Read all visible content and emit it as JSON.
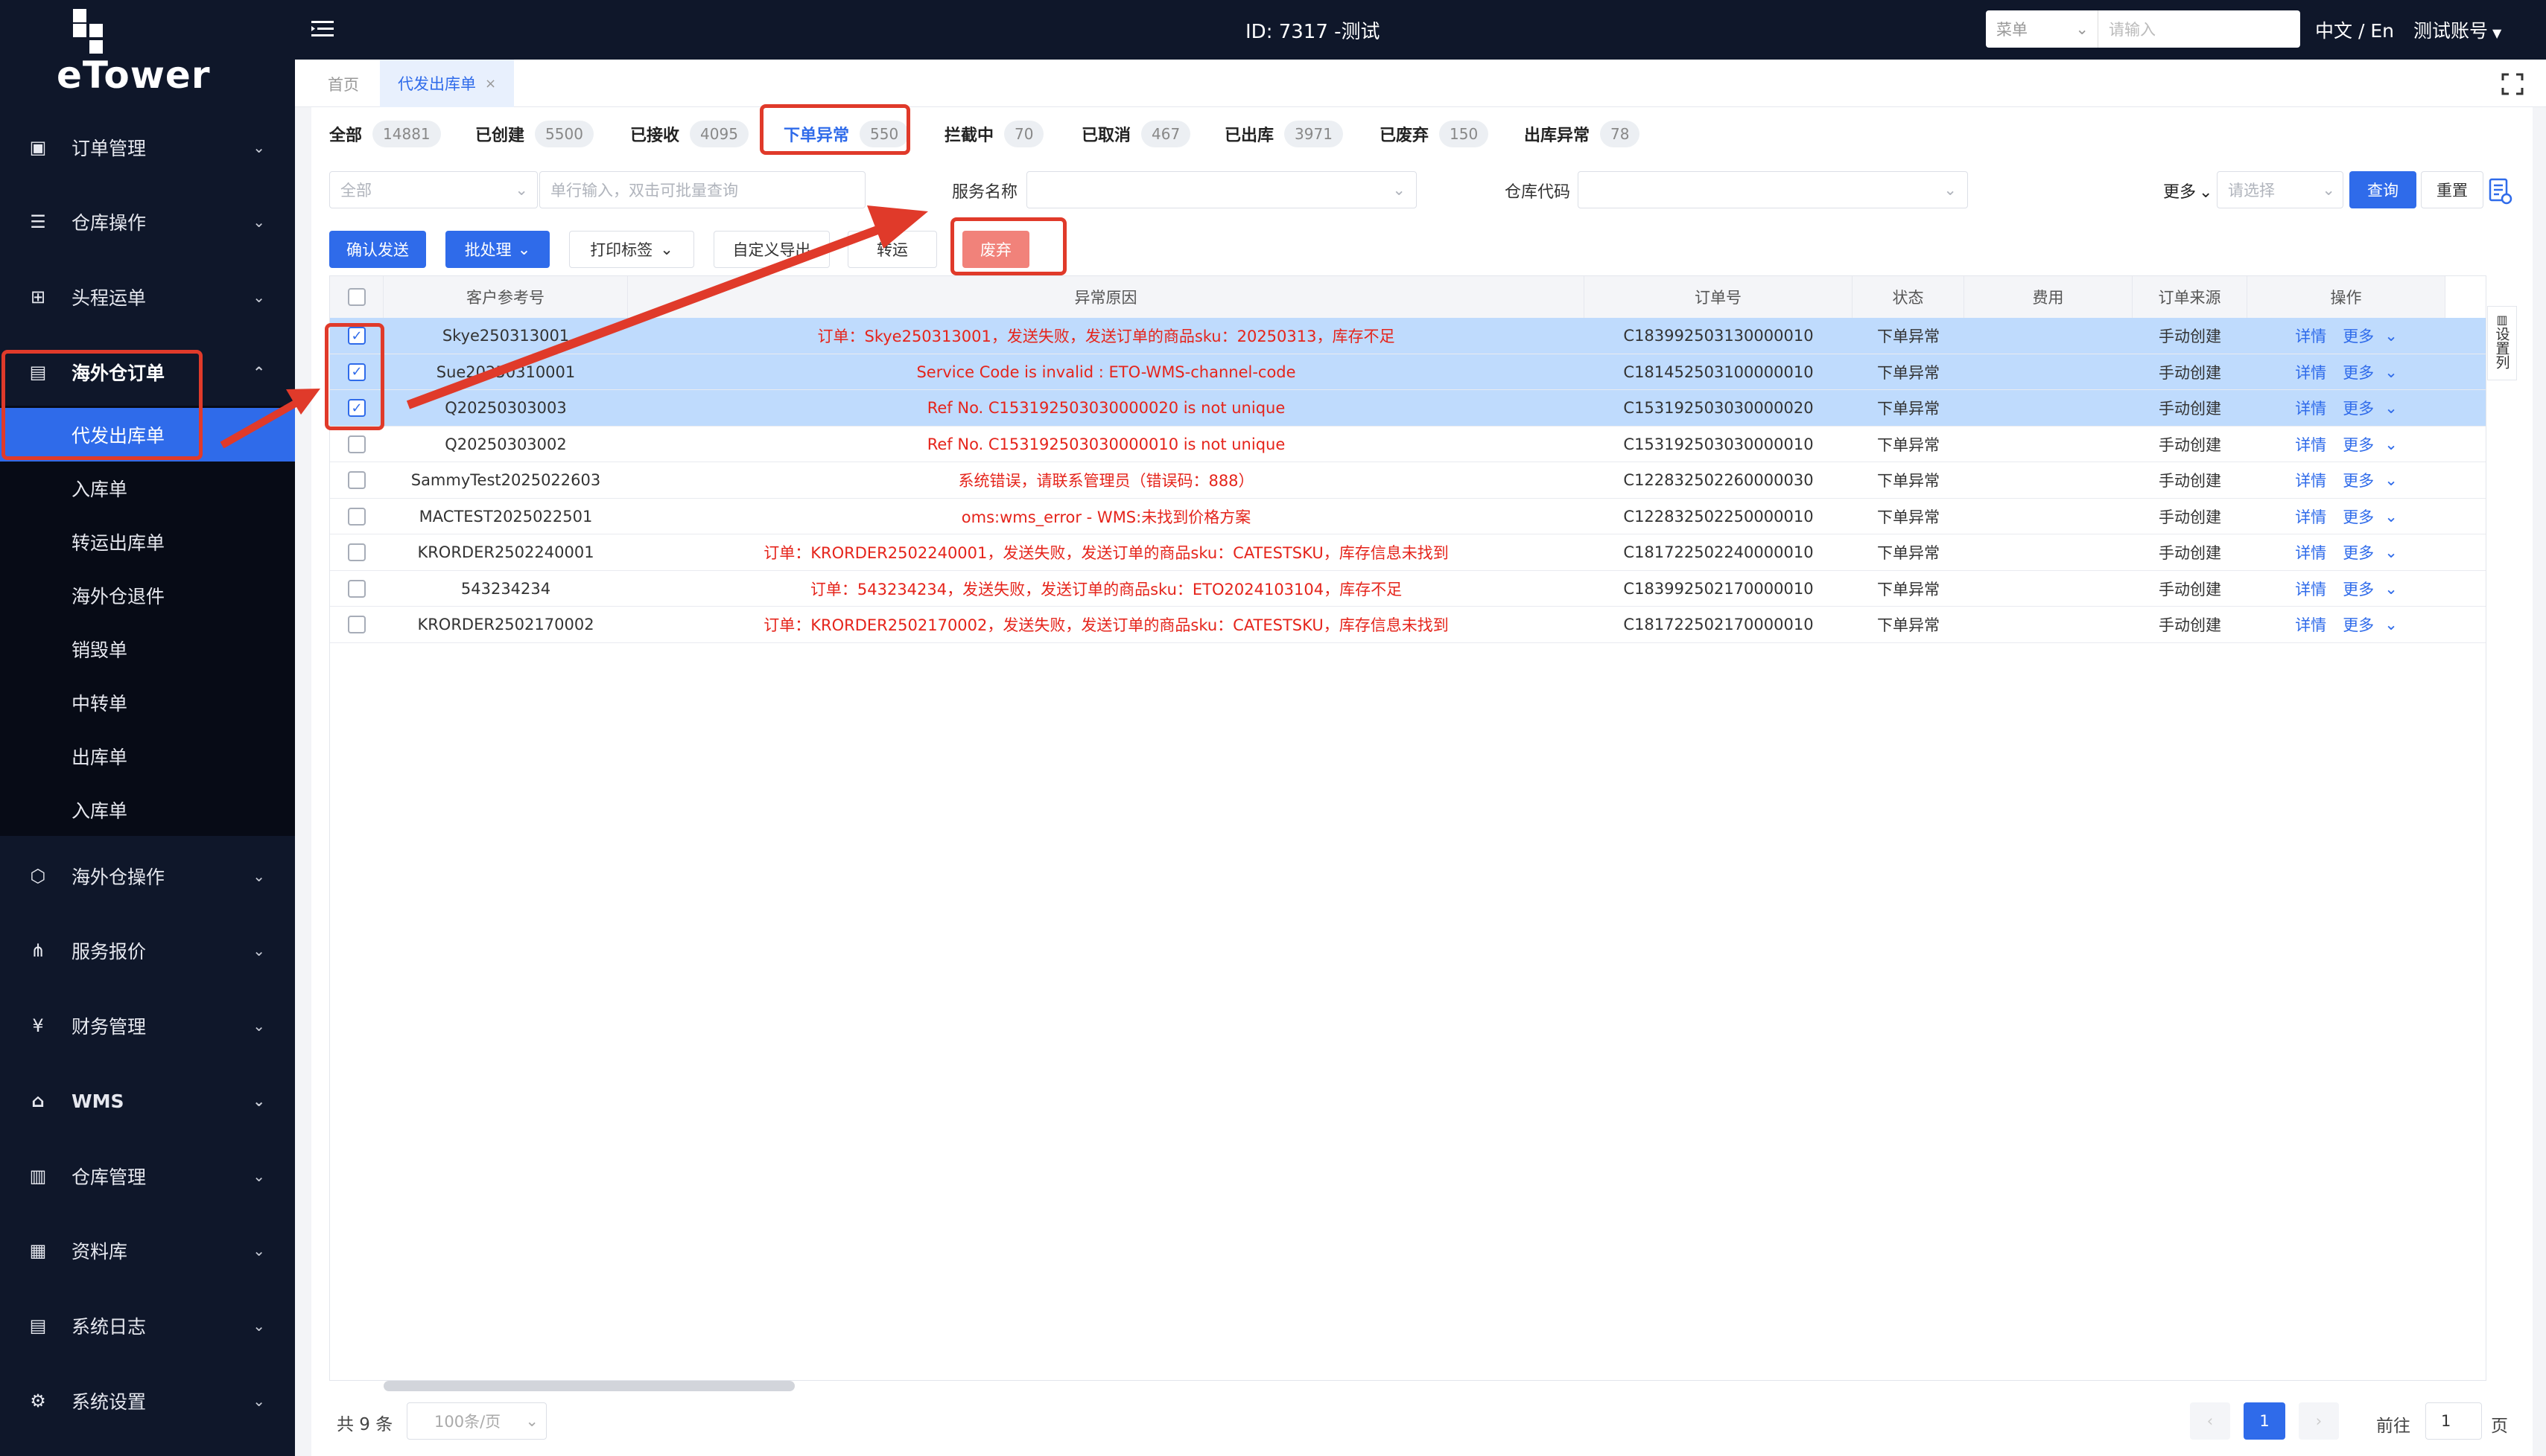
{
  "app": {
    "logo_text": "eTower",
    "title": "ID: 7317 -测试",
    "lang": "中文 / En",
    "account": "测试账号",
    "search_type": "菜单",
    "search_placeholder": "请输入"
  },
  "sidebar": {
    "menu": [
      {
        "label": "订单管理",
        "icon": "order-icon"
      },
      {
        "label": "仓库操作",
        "icon": "warehouse-icon"
      },
      {
        "label": "头程运单",
        "icon": "lock-icon"
      },
      {
        "label": "海外仓订单",
        "icon": "document-icon"
      }
    ],
    "submenu": [
      "代发出库单",
      "入库单",
      "转运出库单",
      "海外仓退件",
      "销毁单",
      "中转单",
      "出库单",
      "入库单"
    ],
    "menu2": [
      {
        "label": "海外仓操作",
        "icon": "box-icon"
      },
      {
        "label": "服务报价",
        "icon": "share-icon"
      },
      {
        "label": "财务管理",
        "icon": "yen-icon"
      },
      {
        "label": "WMS",
        "icon": "home-icon"
      },
      {
        "label": "仓库管理",
        "icon": "building-icon"
      },
      {
        "label": "资料库",
        "icon": "grid-icon"
      },
      {
        "label": "系统日志",
        "icon": "log-icon"
      },
      {
        "label": "系统设置",
        "icon": "gear-icon"
      }
    ]
  },
  "tabs": {
    "home": "首页",
    "current": "代发出库单",
    "close": "×"
  },
  "status_tabs": [
    {
      "label": "全部",
      "count": "14881"
    },
    {
      "label": "已创建",
      "count": "5500"
    },
    {
      "label": "已接收",
      "count": "4095"
    },
    {
      "label": "下单异常",
      "count": "550"
    },
    {
      "label": "拦截中",
      "count": "70"
    },
    {
      "label": "已取消",
      "count": "467"
    },
    {
      "label": "已出库",
      "count": "3971"
    },
    {
      "label": "已废弃",
      "count": "150"
    },
    {
      "label": "出库异常",
      "count": "78"
    }
  ],
  "filters": {
    "type_value": "全部",
    "batch_placeholder": "单行输入，双击可批量查询",
    "service_label": "服务名称",
    "warehouse_label": "仓库代码",
    "more": "更多",
    "select_placeholder": "请选择",
    "query": "查询",
    "reset": "重置"
  },
  "actions": {
    "confirm": "确认发送",
    "batch": "批处理",
    "print": "打印标签",
    "export": "自定义导出",
    "hidden": "转运",
    "discard": "废弃"
  },
  "table": {
    "columns": [
      "客户参考号",
      "异常原因",
      "订单号",
      "状态",
      "费用",
      "订单来源",
      "操作"
    ],
    "settings_label": "设置列",
    "detail": "详情",
    "more": "更多",
    "rows": [
      {
        "ref": "Skye250313001",
        "reason": "订单：Skye250313001，发送失败，发送订单的商品sku：20250313，库存不足",
        "order": "C183992503130000010",
        "status": "下单异常",
        "fee": "",
        "source": "手动创建",
        "selected": true
      },
      {
        "ref": "Sue20250310001",
        "reason": "Service Code is invalid : ETO-WMS-channel-code",
        "order": "C181452503100000010",
        "status": "下单异常",
        "fee": "",
        "source": "手动创建",
        "selected": true
      },
      {
        "ref": "Q20250303003",
        "reason": "Ref No. C153192503030000020 is not unique",
        "order": "C153192503030000020",
        "status": "下单异常",
        "fee": "",
        "source": "手动创建",
        "selected": true
      },
      {
        "ref": "Q20250303002",
        "reason": "Ref No. C153192503030000010 is not unique",
        "order": "C153192503030000010",
        "status": "下单异常",
        "fee": "",
        "source": "手动创建",
        "selected": false
      },
      {
        "ref": "SammyTest2025022603",
        "reason": "系统错误，请联系管理员（错误码：888）",
        "order": "C122832502260000030",
        "status": "下单异常",
        "fee": "",
        "source": "手动创建",
        "selected": false
      },
      {
        "ref": "MACTEST2025022501",
        "reason": "oms:wms_error - WMS:未找到价格方案",
        "order": "C122832502250000010",
        "status": "下单异常",
        "fee": "",
        "source": "手动创建",
        "selected": false
      },
      {
        "ref": "KRORDER2502240001",
        "reason": "订单：KRORDER2502240001，发送失败，发送订单的商品sku：CATESTSKU，库存信息未找到",
        "order": "C181722502240000010",
        "status": "下单异常",
        "fee": "",
        "source": "手动创建",
        "selected": false
      },
      {
        "ref": "543234234",
        "reason": "订单：543234234，发送失败，发送订单的商品sku：ETO2024103104，库存不足",
        "order": "C183992502170000010",
        "status": "下单异常",
        "fee": "",
        "source": "手动创建",
        "selected": false
      },
      {
        "ref": "KRORDER2502170002",
        "reason": "订单：KRORDER2502170002，发送失败，发送订单的商品sku：CATESTSKU，库存信息未找到",
        "order": "C181722502170000010",
        "status": "下单异常",
        "fee": "",
        "source": "手动创建",
        "selected": false
      }
    ]
  },
  "pagination": {
    "total": "共 9 条",
    "page_size": "100条/页",
    "current": "1",
    "goto_prefix": "前往",
    "goto_value": "1",
    "goto_suffix": "页",
    "prev": "‹",
    "next": "›"
  },
  "colors": {
    "sidebar": "#0f172a",
    "accent": "#2f6bea",
    "error": "#e5241b",
    "highlight": "#e03a2a",
    "selected_row": "#bfdbfd"
  }
}
